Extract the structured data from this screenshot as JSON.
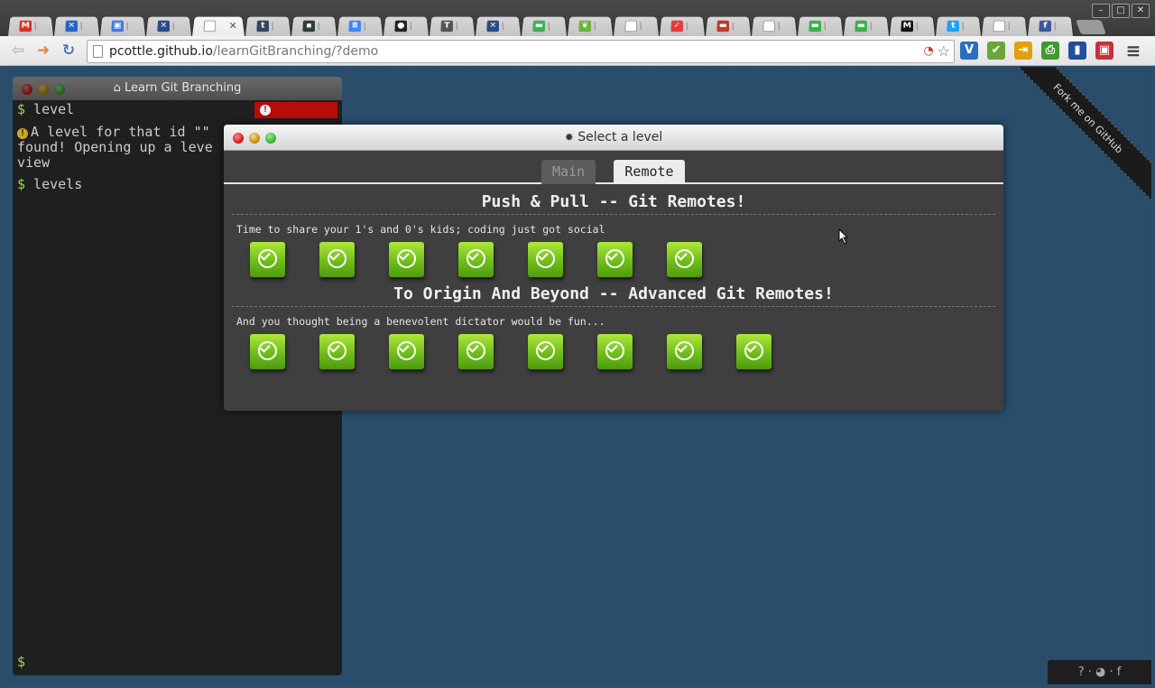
{
  "browser": {
    "tabs": [
      {
        "icon": "gmail-icon",
        "glyph": "M",
        "color": "#d93025",
        "text_color": "#fff",
        "active": false
      },
      {
        "icon": "tools-icon",
        "glyph": "✕",
        "color": "#2a63c4",
        "text_color": "#fff",
        "active": false
      },
      {
        "icon": "contacts-icon",
        "glyph": "▣",
        "color": "#3b78e7",
        "text_color": "#fff",
        "active": false
      },
      {
        "icon": "tools-icon",
        "glyph": "✕",
        "color": "#2a4a88",
        "text_color": "#fff",
        "active": false
      },
      {
        "icon": "page-icon",
        "glyph": "",
        "color": "#ffffff",
        "text_color": "#555",
        "active": true
      },
      {
        "icon": "tumblr-icon",
        "glyph": "t",
        "color": "#36465d",
        "text_color": "#fff",
        "active": false
      },
      {
        "icon": "image-icon",
        "glyph": "▪",
        "color": "#2c3e3e",
        "text_color": "#fff",
        "active": false
      },
      {
        "icon": "google-icon",
        "glyph": "8",
        "color": "#4285f4",
        "text_color": "#fff",
        "active": false
      },
      {
        "icon": "github-icon",
        "glyph": "●",
        "color": "#222222",
        "text_color": "#fff",
        "active": false
      },
      {
        "icon": "text-icon",
        "glyph": "T",
        "color": "#555555",
        "text_color": "#fff",
        "active": false
      },
      {
        "icon": "tools-icon",
        "glyph": "✕",
        "color": "#2a4a88",
        "text_color": "#fff",
        "active": false
      },
      {
        "icon": "chat-icon",
        "glyph": "▬",
        "color": "#3eae5b",
        "text_color": "#fff",
        "active": false
      },
      {
        "icon": "leaf-icon",
        "glyph": "❦",
        "color": "#6cb33f",
        "text_color": "#fff",
        "active": false
      },
      {
        "icon": "page-icon",
        "glyph": "",
        "color": "#ffffff",
        "text_color": "#555",
        "active": false
      },
      {
        "icon": "check-icon",
        "glyph": "✓",
        "color": "#e23c3c",
        "text_color": "#fff",
        "active": false
      },
      {
        "icon": "video-icon",
        "glyph": "▬",
        "color": "#c0392b",
        "text_color": "#fff",
        "active": false
      },
      {
        "icon": "page-icon",
        "glyph": "",
        "color": "#ffffff",
        "text_color": "#555",
        "active": false
      },
      {
        "icon": "card-icon",
        "glyph": "▬",
        "color": "#37b34a",
        "text_color": "#fff",
        "active": false
      },
      {
        "icon": "card-icon",
        "glyph": "▬",
        "color": "#37b34a",
        "text_color": "#fff",
        "active": false
      },
      {
        "icon": "medium-icon",
        "glyph": "M",
        "color": "#111111",
        "text_color": "#fff",
        "active": false
      },
      {
        "icon": "twitter-icon",
        "glyph": "t",
        "color": "#1da1f2",
        "text_color": "#fff",
        "active": false
      },
      {
        "icon": "page-icon",
        "glyph": "",
        "color": "#ffffff",
        "text_color": "#555",
        "active": false
      },
      {
        "icon": "facebook-icon",
        "glyph": "f",
        "color": "#3b5998",
        "text_color": "#fff",
        "active": false
      }
    ],
    "window_controls": [
      "–",
      "□",
      "✕"
    ],
    "url_host": "pcottle.github.io",
    "url_rest": "/learnGitBranching/?demo",
    "extensions": [
      {
        "name": "vimeo-icon",
        "glyph": "V",
        "color": "#2a6fbd"
      },
      {
        "name": "check-ext-icon",
        "glyph": "✔",
        "color": "#6aa63a"
      },
      {
        "name": "exit-icon",
        "glyph": "⇥",
        "color": "#e0a010"
      },
      {
        "name": "print-icon",
        "glyph": "⎙",
        "color": "#3f9a2f"
      },
      {
        "name": "chart-icon",
        "glyph": "▮",
        "color": "#234f9a"
      },
      {
        "name": "save-icon",
        "glyph": "▣",
        "color": "#c9303a"
      }
    ],
    "menu_glyph": "≡"
  },
  "terminal": {
    "title": "Learn Git Branching",
    "lines": [
      {
        "prompt": "$",
        "text": " level"
      },
      {
        "warn": "!",
        "text": "A level for that id \"\" was not found! Opening up a level selection view"
      },
      {
        "prompt": "$",
        "text": " levels"
      }
    ],
    "line2a": "A level for that id \"\"",
    "line2b": "found! Opening up a leve",
    "line2c": "view",
    "prompt": "$"
  },
  "modal": {
    "title": "Select a level",
    "tabs": {
      "main": "Main",
      "remote": "Remote"
    },
    "sections": [
      {
        "title": "Push & Pull -- Git Remotes!",
        "description": "Time to share your 1's and 0's kids; coding just got social",
        "level_count": 7
      },
      {
        "title": "To Origin And Beyond -- Advanced Git Remotes!",
        "description": "And you thought being a benevolent dictator would be fun...",
        "level_count": 8
      }
    ]
  },
  "fork_ribbon": "Fork me on GitHub",
  "footer": "? · ◕ · f"
}
